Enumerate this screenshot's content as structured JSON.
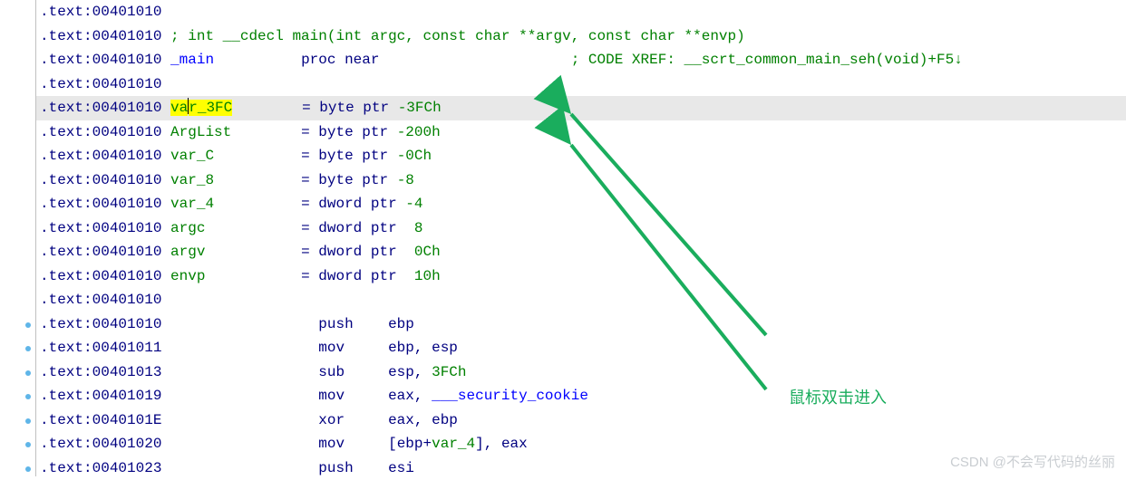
{
  "lines": [
    {
      "i": 0,
      "prefix": ".text:",
      "addr": "00401010"
    },
    {
      "i": 1,
      "prefix": ".text:",
      "addr": "00401010",
      "comment": "; int __cdecl main(int argc, const char **argv, const char **envp)"
    },
    {
      "i": 2,
      "prefix": ".text:",
      "addr": "00401010",
      "label": "_main",
      "middle": "proc near",
      "xref": "; CODE XREF: __scrt_common_main_seh(void)+F5↓"
    },
    {
      "i": 3,
      "prefix": ".text:",
      "addr": "00401010"
    },
    {
      "i": 4,
      "highlighted": true,
      "prefix": ".text:",
      "addr": "00401010",
      "varname_pre": "v",
      "varname_cur": "a",
      "varname_post": "r_3FC",
      "mid": "= byte ptr ",
      "val": "-3FCh"
    },
    {
      "i": 5,
      "prefix": ".text:",
      "addr": "00401010",
      "varname": "ArgList",
      "mid": "= byte ptr ",
      "val": "-200h"
    },
    {
      "i": 6,
      "prefix": ".text:",
      "addr": "00401010",
      "varname": "var_C",
      "mid": "= byte ptr ",
      "val": "-0Ch"
    },
    {
      "i": 7,
      "prefix": ".text:",
      "addr": "00401010",
      "varname": "var_8",
      "mid": "= byte ptr ",
      "val": "-8"
    },
    {
      "i": 8,
      "prefix": ".text:",
      "addr": "00401010",
      "varname": "var_4",
      "mid": "= dword ptr ",
      "val": "-4"
    },
    {
      "i": 9,
      "prefix": ".text:",
      "addr": "00401010",
      "varname": "argc",
      "mid": "= dword ptr  ",
      "val": "8"
    },
    {
      "i": 10,
      "prefix": ".text:",
      "addr": "00401010",
      "varname": "argv",
      "mid": "= dword ptr  ",
      "val": "0Ch"
    },
    {
      "i": 11,
      "prefix": ".text:",
      "addr": "00401010",
      "varname": "envp",
      "mid": "= dword ptr  ",
      "val": "10h"
    },
    {
      "i": 12,
      "prefix": ".text:",
      "addr": "00401010"
    },
    {
      "i": 13,
      "bullet": true,
      "prefix": ".text:",
      "addr": "00401010",
      "op": "push",
      "args": [
        {
          "t": "ebp",
          "c": "navy"
        }
      ]
    },
    {
      "i": 14,
      "bullet": true,
      "prefix": ".text:",
      "addr": "00401011",
      "op": "mov",
      "args": [
        {
          "t": "ebp",
          "c": "navy"
        },
        {
          "t": ", ",
          "c": "navy"
        },
        {
          "t": "esp",
          "c": "navy"
        }
      ]
    },
    {
      "i": 15,
      "bullet": true,
      "prefix": ".text:",
      "addr": "00401013",
      "op": "sub",
      "args": [
        {
          "t": "esp",
          "c": "navy"
        },
        {
          "t": ", ",
          "c": "navy"
        },
        {
          "t": "3FCh",
          "c": "green"
        }
      ]
    },
    {
      "i": 16,
      "bullet": true,
      "prefix": ".text:",
      "addr": "00401019",
      "op": "mov",
      "args": [
        {
          "t": "eax",
          "c": "navy"
        },
        {
          "t": ", ",
          "c": "navy"
        },
        {
          "t": "___security_cookie",
          "c": "blue"
        }
      ]
    },
    {
      "i": 17,
      "bullet": true,
      "prefix": ".text:",
      "addr": "0040101E",
      "op": "xor",
      "args": [
        {
          "t": "eax",
          "c": "navy"
        },
        {
          "t": ", ",
          "c": "navy"
        },
        {
          "t": "ebp",
          "c": "navy"
        }
      ]
    },
    {
      "i": 18,
      "bullet": true,
      "prefix": ".text:",
      "addr": "00401020",
      "op": "mov",
      "args": [
        {
          "t": "[",
          "c": "navy"
        },
        {
          "t": "ebp",
          "c": "navy"
        },
        {
          "t": "+",
          "c": "navy"
        },
        {
          "t": "var_4",
          "c": "green"
        },
        {
          "t": "], ",
          "c": "navy"
        },
        {
          "t": "eax",
          "c": "navy"
        }
      ]
    },
    {
      "i": 19,
      "bullet": true,
      "prefix": ".text:",
      "addr": "00401023",
      "op": "push",
      "args": [
        {
          "t": "esi",
          "c": "navy"
        }
      ]
    }
  ],
  "annotation_text": "鼠标双击进入",
  "watermark": "CSDN @不会写代码的丝丽",
  "cols": {
    "label": 15,
    "op": 32,
    "arg": 40
  }
}
